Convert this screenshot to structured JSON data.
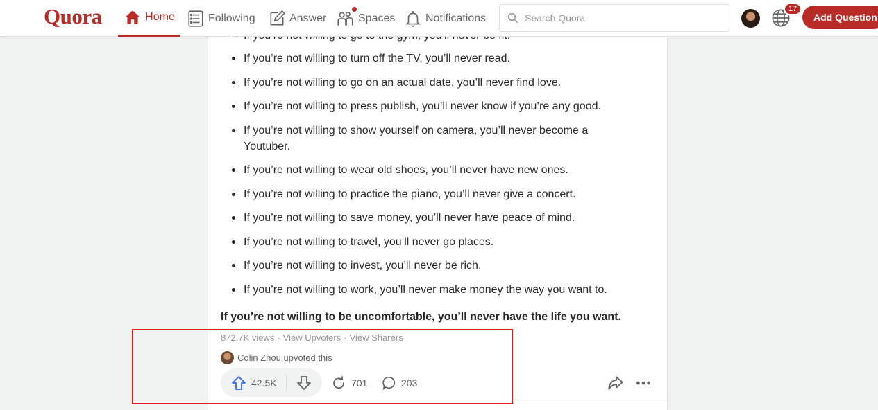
{
  "header": {
    "logo": "Quora",
    "nav": [
      {
        "label": "Home",
        "icon": "home-icon",
        "active": true
      },
      {
        "label": "Following",
        "icon": "following-icon"
      },
      {
        "label": "Answer",
        "icon": "answer-icon"
      },
      {
        "label": "Spaces",
        "icon": "spaces-icon"
      },
      {
        "label": "Notifications",
        "icon": "bell-icon"
      }
    ],
    "search_placeholder": "Search Quora",
    "language_badge": "17",
    "add_question": "Add Question",
    "brand_color": "#b92b27"
  },
  "answer": {
    "bullets": [
      "If you’re not willing to go to the gym, you’ll never be fit.",
      "If you’re not willing to turn off the TV, you’ll never read.",
      "If you’re not willing to go on an actual date, you’ll never find love.",
      "If you’re not willing to press publish, you’ll never know if you’re any good.",
      "If you’re not willing to show yourself on camera, you’ll never become a Youtuber.",
      "If you’re not willing to wear old shoes, you’ll never have new ones.",
      "If you’re not willing to practice the piano, you’ll never give a concert.",
      "If you’re not willing to save money, you’ll never have peace of mind.",
      "If you’re not willing to travel, you’ll never go places.",
      "If you’re not willing to invest, you’ll never be rich.",
      "If you’re not willing to work, you’ll never make money the way you want to."
    ],
    "conclusion": "If you’re not willing to be uncomfortable, you’ll never have the life you want.",
    "views": "872.7K views",
    "separator": "·",
    "view_upvoters": "View Upvoters",
    "view_sharers": "View Sharers",
    "upvoted_by": "Colin Zhou upvoted this",
    "upvotes": "42.5K",
    "shares": "701",
    "comments": "203"
  }
}
